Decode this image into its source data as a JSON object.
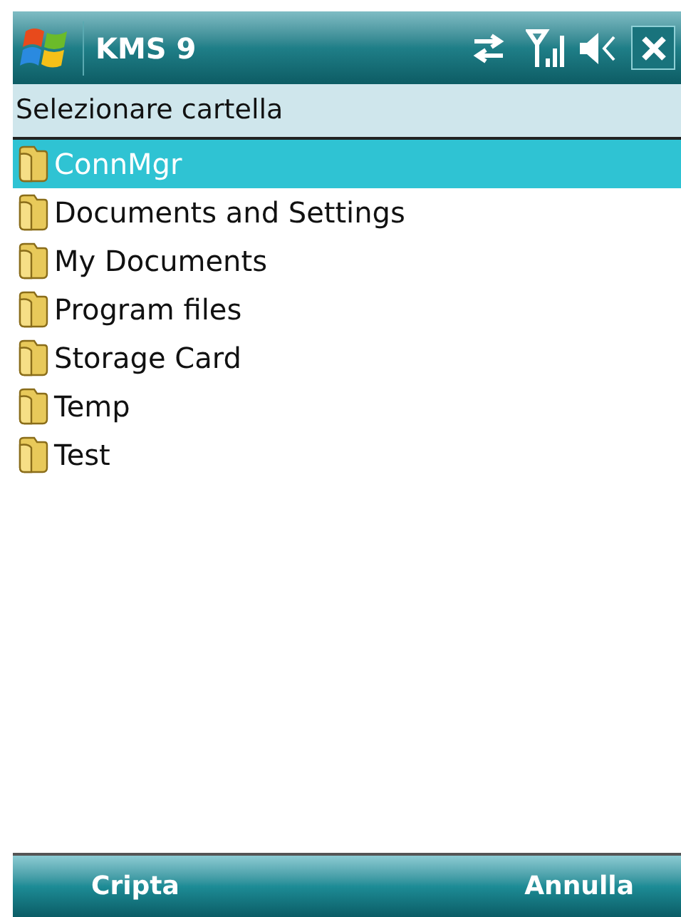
{
  "title_bar": {
    "title": "KMS 9"
  },
  "header": {
    "title": "Selezionare cartella"
  },
  "folders": [
    {
      "name": "ConnMgr",
      "selected": true
    },
    {
      "name": "Documents and Settings",
      "selected": false
    },
    {
      "name": "My Documents",
      "selected": false
    },
    {
      "name": "Program files",
      "selected": false
    },
    {
      "name": "Storage Card",
      "selected": false
    },
    {
      "name": "Temp",
      "selected": false
    },
    {
      "name": "Test",
      "selected": false
    }
  ],
  "softkeys": {
    "left": "Cripta",
    "right": "Annulla"
  }
}
